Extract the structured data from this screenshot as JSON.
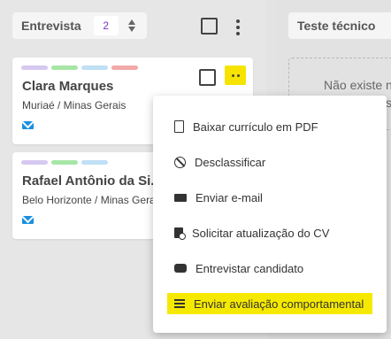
{
  "column1": {
    "title": "Entrevista",
    "count": "2"
  },
  "column2": {
    "title": "Teste técnico",
    "empty_text": "Não existe n",
    "empty_text_2": "s"
  },
  "cards": [
    {
      "name": "Clara Marques",
      "location": "Muriaé / Minas Gerais",
      "tags": [
        "#d6c8f0",
        "#a6e6a6",
        "#bfe0f5",
        "#f2a9a9"
      ]
    },
    {
      "name": "Rafael Antônio da Si...",
      "location": "Belo Horizonte / Minas Gera",
      "tags": [
        "#d6c8f0",
        "#a6e6a6",
        "#bfe0f5"
      ]
    }
  ],
  "menu": {
    "items": [
      {
        "label": "Baixar currículo em PDF",
        "icon": "pdf-download-icon"
      },
      {
        "label": "Desclassificar",
        "icon": "ban-icon"
      },
      {
        "label": "Enviar e-mail",
        "icon": "mail-icon"
      },
      {
        "label": "Solicitar atualização do CV",
        "icon": "document-refresh-icon"
      },
      {
        "label": "Entrevistar candidato",
        "icon": "chat-icon"
      },
      {
        "label": "Enviar avaliação comportamental",
        "icon": "checklist-icon",
        "highlighted": true
      }
    ]
  },
  "colors": {
    "highlight": "#f6e900",
    "badge_text": "#7a32c8",
    "mail_icon": "#1a8fe0"
  }
}
